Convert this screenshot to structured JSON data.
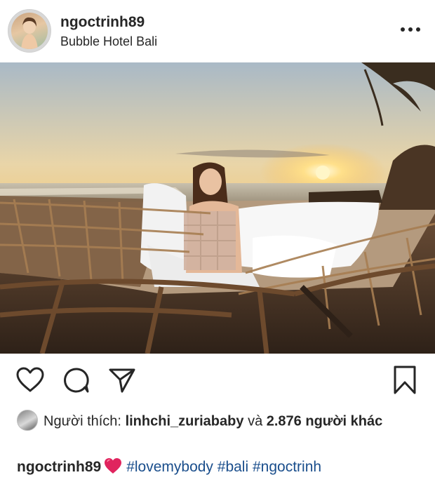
{
  "post": {
    "username": "ngoctrinh89",
    "location": "Bubble Hotel Bali",
    "more_icon": "more-horizontal-icon"
  },
  "actions": {
    "like_icon": "heart-outline-icon",
    "comment_icon": "comment-icon",
    "share_icon": "share-icon",
    "save_icon": "bookmark-icon"
  },
  "likes": {
    "prefix": "Người thích:",
    "liker": "linhchi_zuriababy",
    "connector": "và",
    "others": "2.876 người khác"
  },
  "caption": {
    "username": "ngoctrinh89",
    "emoji": "red-heart",
    "hashtags": [
      "#lovemybody",
      "#bali",
      "#ngoctrinh"
    ]
  },
  "colors": {
    "text": "#262626",
    "hashtag": "#1a4e8c",
    "heart": "#e0245e"
  }
}
